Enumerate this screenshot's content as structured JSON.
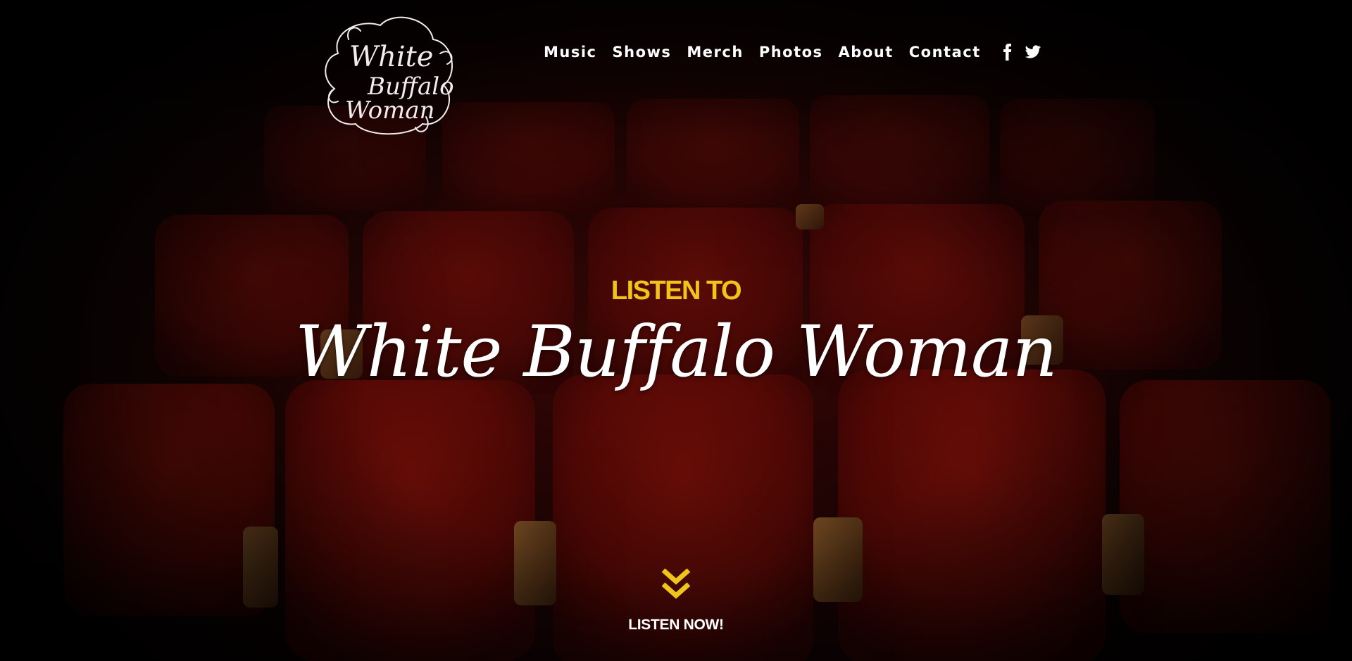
{
  "brand": {
    "logo_text": [
      "White",
      "Buffalo",
      "Woman"
    ]
  },
  "nav": {
    "items": [
      {
        "label": "Music"
      },
      {
        "label": "Shows"
      },
      {
        "label": "Merch"
      },
      {
        "label": "Photos"
      },
      {
        "label": "About"
      },
      {
        "label": "Contact"
      }
    ],
    "social": [
      {
        "icon": "facebook-icon"
      },
      {
        "icon": "twitter-icon"
      }
    ]
  },
  "hero": {
    "kicker": "LISTEN TO",
    "title": "White Buffalo Woman",
    "cta_label": "LISTEN NOW!",
    "cta_icon": "double-chevron-down-icon"
  },
  "colors": {
    "accent": "#f0c419",
    "text": "#ffffff",
    "seat": "#6e0c07",
    "background": "#070202"
  }
}
